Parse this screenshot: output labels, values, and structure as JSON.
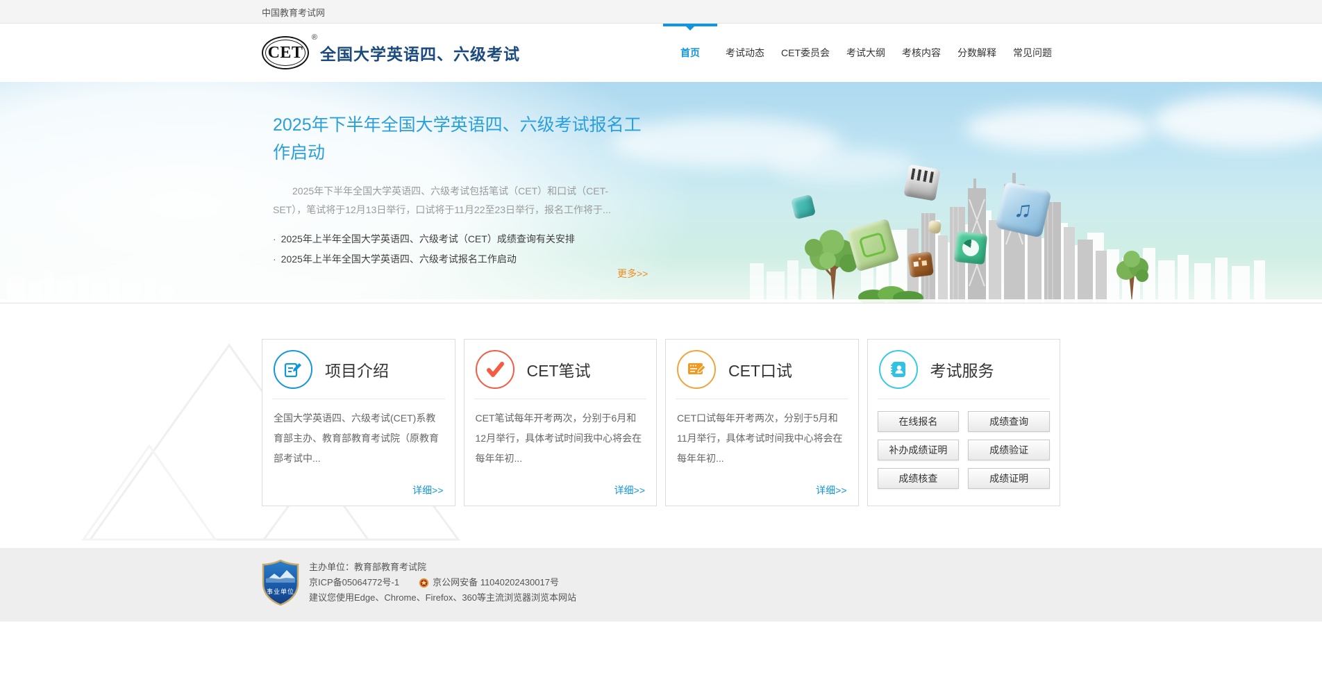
{
  "topbar": {
    "site_name": "中国教育考试网"
  },
  "header": {
    "logo": {
      "text": "CET",
      "reg": "®",
      "icon": "cet-oval-logo"
    },
    "title": "全国大学英语四、六级考试",
    "nav": [
      {
        "label": "首页",
        "active": true
      },
      {
        "label": "考试动态"
      },
      {
        "label": "CET委员会"
      },
      {
        "label": "考试大纲"
      },
      {
        "label": "考核内容"
      },
      {
        "label": "分数解释"
      },
      {
        "label": "常见问题"
      }
    ]
  },
  "hero": {
    "headline": "2025年下半年全国大学英语四、六级考试报名工作启动",
    "summary": "2025年下半年全国大学英语四、六级考试包括笔试（CET）和口试（CET-SET），笔试将于12月13日举行，口试将于11月22至23日举行，报名工作将于...",
    "news": [
      "2025年上半年全国大学英语四、六级考试（CET）成绩查询有关安排",
      "2025年上半年全国大学英语四、六级考试报名工作启动"
    ],
    "more_label": "更多>>",
    "decor": {
      "music_note": "♫"
    }
  },
  "cards": [
    {
      "title": "项目介绍",
      "icon": "document-pencil-icon",
      "accent": "#1296db",
      "body": "全国大学英语四、六级考试(CET)系教育部主办、教育部教育考试院（原教育部考试中...",
      "link_label": "详细>>"
    },
    {
      "title": "CET笔试",
      "icon": "checkmark-icon",
      "accent": "#f55b41",
      "body": "CET笔试每年开考两次，分别于6月和12月举行，具体考试时间我中心将会在每年年初...",
      "link_label": "详细>>"
    },
    {
      "title": "CET口试",
      "icon": "browser-pencil-icon",
      "accent": "#f0a43c",
      "body": "CET口试每年开考两次，分别于5月和11月举行，具体考试时间我中心将会在每年年初...",
      "link_label": "详细>>"
    },
    {
      "title": "考试服务",
      "icon": "contact-book-icon",
      "accent": "#35c9e8",
      "buttons": [
        "在线报名",
        "成绩查询",
        "补办成绩证明",
        "成绩验证",
        "成绩核查",
        "成绩证明"
      ]
    }
  ],
  "footer": {
    "badge_label": "事业单位",
    "badge_icon": "institution-shield-icon",
    "organizer": "主办单位：教育部教育考试院",
    "icp": "京ICP备05064772号-1",
    "police_icon": "police-badge-icon",
    "police": "京公网安备 11040202430017号",
    "browser_tip": "建议您使用Edge、Chrome、Firefox、360等主流浏览器浏览本网站"
  },
  "colors": {
    "accent_blue": "#1296db",
    "title_navy": "#1b4a7e",
    "headline_blue": "#2b9fd9",
    "more_orange": "#f28b1f",
    "card_red": "#f55b41",
    "card_orange": "#f0a43c",
    "card_cyan": "#35c9e8",
    "footer_bg": "#eeeeee"
  }
}
